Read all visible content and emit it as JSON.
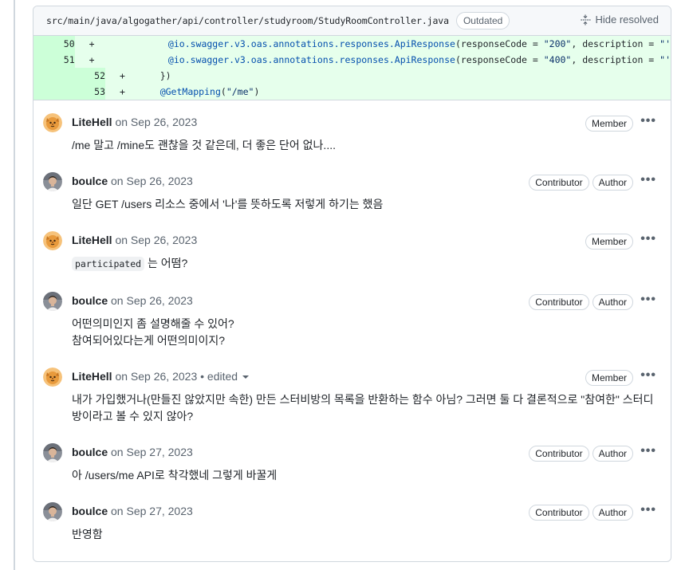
{
  "file": {
    "path": "src/main/java/algogather/api/controller/studyroom/StudyRoomController.java",
    "status": "Outdated",
    "hide_resolved": "Hide resolved"
  },
  "diff_lines": [
    {
      "num": "50",
      "marker": "+",
      "indent": "            ",
      "annotation": "@io.swagger.v3.oas.annotations.responses.ApiResponse",
      "rest_a": "(responseCode = ",
      "str_a": "\"200\"",
      "rest_b": ", description = ",
      "str_b": "\"'"
    },
    {
      "num": "51",
      "marker": "+",
      "indent": "            ",
      "annotation": "@io.swagger.v3.oas.annotations.responses.ApiResponse",
      "rest_a": "(responseCode = ",
      "str_a": "\"400\"",
      "rest_b": ", description = ",
      "str_b": "\"'"
    },
    {
      "num": "52",
      "marker": "+",
      "indent": "    ",
      "annotation": "",
      "rest_a": "})",
      "str_a": "",
      "rest_b": "",
      "str_b": ""
    },
    {
      "num": "53",
      "marker": "+",
      "indent": "    ",
      "annotation": "@GetMapping",
      "rest_a": "(",
      "str_a": "\"/me\"",
      "rest_b": ")",
      "str_b": ""
    }
  ],
  "comments": [
    {
      "author": "LiteHell",
      "date": "on Sep 26, 2023",
      "edited": "",
      "badges": [
        "Member"
      ],
      "lines": [
        "/me 말고 /mine도 괜찮을 것 같은데, 더 좋은 단어 없나...."
      ]
    },
    {
      "author": "boulce",
      "date": "on Sep 26, 2023",
      "edited": "",
      "badges": [
        "Contributor",
        "Author"
      ],
      "lines": [
        "일단 GET /users 리소스 중에서 '나'를 뜻하도록 저렇게 하기는 했음"
      ]
    },
    {
      "author": "LiteHell",
      "date": "on Sep 26, 2023",
      "edited": "",
      "badges": [
        "Member"
      ],
      "code": "participated",
      "lines": [
        " 는 어떰?"
      ]
    },
    {
      "author": "boulce",
      "date": "on Sep 26, 2023",
      "edited": "",
      "badges": [
        "Contributor",
        "Author"
      ],
      "lines": [
        "어떤의미인지 좀 설명해줄 수 있어?",
        "참여되어있다는게 어떤의미이지?"
      ]
    },
    {
      "author": "LiteHell",
      "date": "on Sep 26, 2023",
      "edited": "• edited",
      "badges": [
        "Member"
      ],
      "lines": [
        "내가 가입했거나(만들진 않았지만 속한) 만든 스터비방의 목록을 반환하는 함수 아님? 그러면 둘 다 결론적으로 \"참여한\" 스터디",
        "방이라고 볼 수 있지 않아?"
      ]
    },
    {
      "author": "boulce",
      "date": "on Sep 27, 2023",
      "edited": "",
      "badges": [
        "Contributor",
        "Author"
      ],
      "lines": [
        "아 /users/me API로 착각했네 그렇게 바꿀게"
      ]
    },
    {
      "author": "boulce",
      "date": "on Sep 27, 2023",
      "edited": "",
      "badges": [
        "Contributor",
        "Author"
      ],
      "lines": [
        "반영함"
      ]
    }
  ],
  "colors": {
    "diff_bg": "#e6ffec",
    "diff_ln_bg": "#ccffd8",
    "border": "#d0d7de",
    "muted": "#59636e"
  }
}
